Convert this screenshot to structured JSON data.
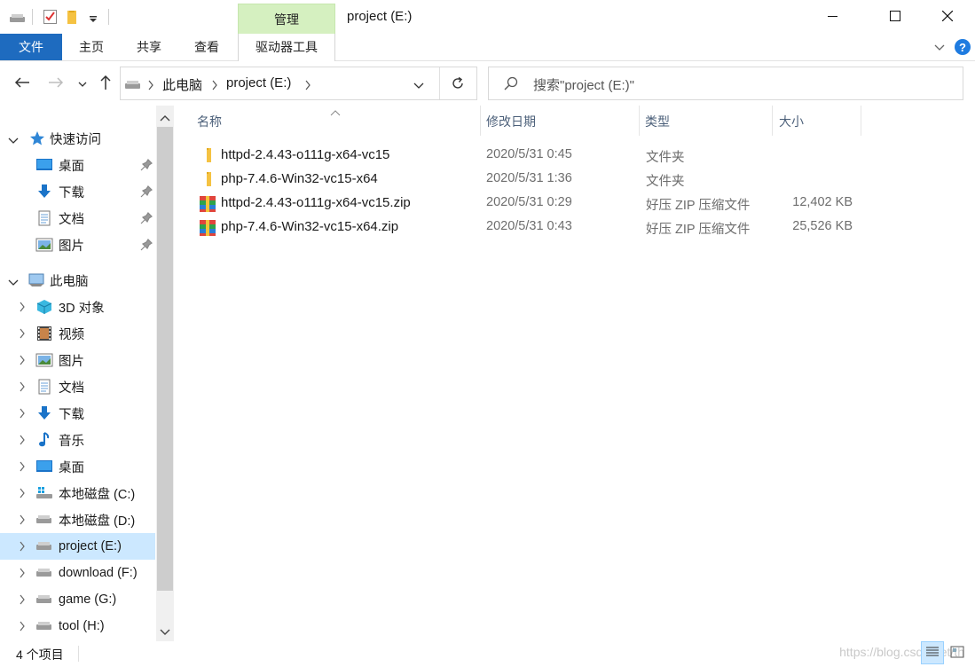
{
  "titlebar": {
    "context_tab_group": "管理",
    "window_title": "project (E:)"
  },
  "ribbon": {
    "tabs": [
      "文件",
      "主页",
      "共享",
      "查看",
      "驱动器工具"
    ]
  },
  "address": {
    "segments": [
      "此电脑",
      "project (E:)"
    ]
  },
  "search": {
    "placeholder": "搜索\"project (E:)\""
  },
  "nav": {
    "quick_access": "快速访问",
    "quick_items": [
      "桌面",
      "下载",
      "文档",
      "图片"
    ],
    "this_pc": "此电脑",
    "pc_items": [
      "3D 对象",
      "视频",
      "图片",
      "文档",
      "下载",
      "音乐",
      "桌面",
      "本地磁盘 (C:)",
      "本地磁盘 (D:)",
      "project (E:)",
      "download (F:)",
      "game (G:)",
      "tool (H:)"
    ],
    "selected_item": "project (E:)"
  },
  "columns": {
    "name": "名称",
    "date": "修改日期",
    "type": "类型",
    "size": "大小"
  },
  "files": [
    {
      "name": "httpd-2.4.43-o111g-x64-vc15",
      "date": "2020/5/31 0:45",
      "type": "文件夹",
      "size": "",
      "icon": "folder-icon"
    },
    {
      "name": "php-7.4.6-Win32-vc15-x64",
      "date": "2020/5/31 1:36",
      "type": "文件夹",
      "size": "",
      "icon": "folder-icon"
    },
    {
      "name": "httpd-2.4.43-o111g-x64-vc15.zip",
      "date": "2020/5/31 0:29",
      "type": "好压 ZIP 压缩文件",
      "size": "12,402 KB",
      "icon": "zip-archive-icon"
    },
    {
      "name": "php-7.4.6-Win32-vc15-x64.zip",
      "date": "2020/5/31 0:43",
      "type": "好压 ZIP 压缩文件",
      "size": "25,526 KB",
      "icon": "zip-archive-icon"
    }
  ],
  "status": {
    "item_count": "4 个项目",
    "watermark": "https://blog.csdn.net/th"
  },
  "colors": {
    "file_tab": "#1e6bbf",
    "context_tab": "#d5f0c0",
    "selection": "#cce8ff",
    "folder": "#f5c242",
    "help": "#1e7be0"
  }
}
